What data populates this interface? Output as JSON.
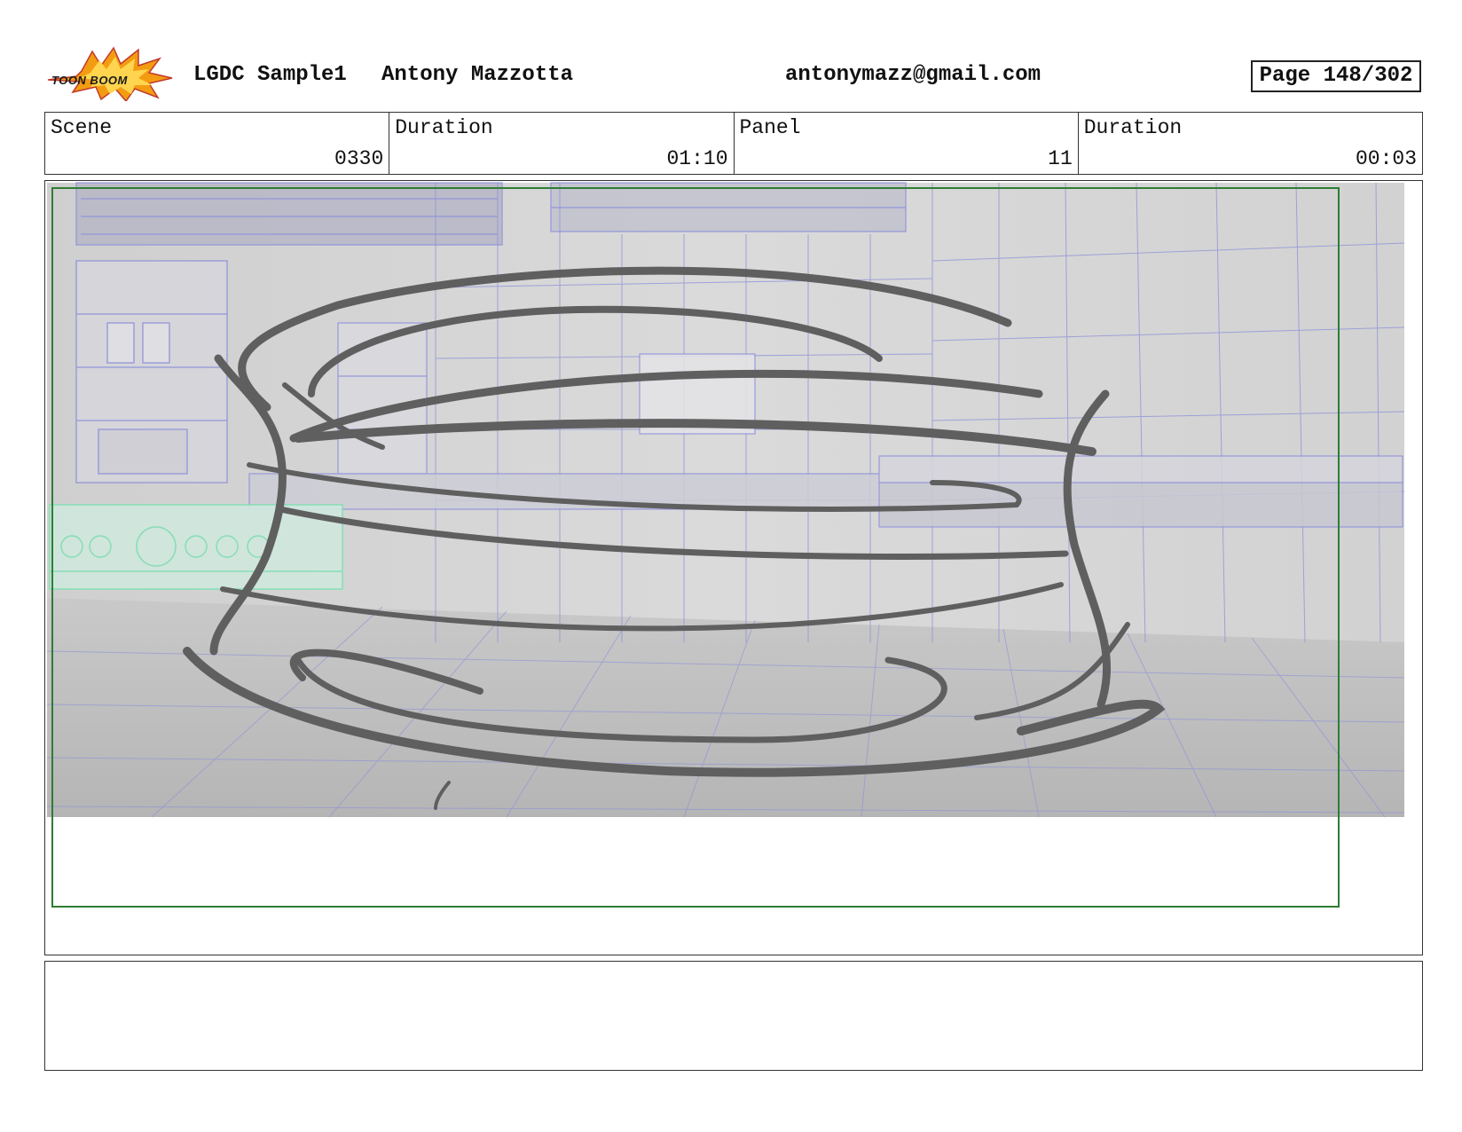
{
  "header": {
    "logo_text": "TOON BOOM",
    "project": "LGDC Sample1",
    "author": "Antony Mazzotta",
    "email": "antonymazz@gmail.com",
    "page": "Page 148/302"
  },
  "info": {
    "scene_label": "Scene",
    "scene_value": "0330",
    "scene_duration_label": "Duration",
    "scene_duration_value": "01:10",
    "panel_label": "Panel",
    "panel_value": "11",
    "panel_duration_label": "Duration",
    "panel_duration_value": "00:03"
  },
  "panel": {
    "content": "kitchen-background-with-whirlwind-sketch",
    "safe_frame_color": "#2e7d32",
    "sketch_color": "#5f5f5f",
    "grid_color": "#8c8fd9"
  },
  "notes": {
    "text": ""
  }
}
